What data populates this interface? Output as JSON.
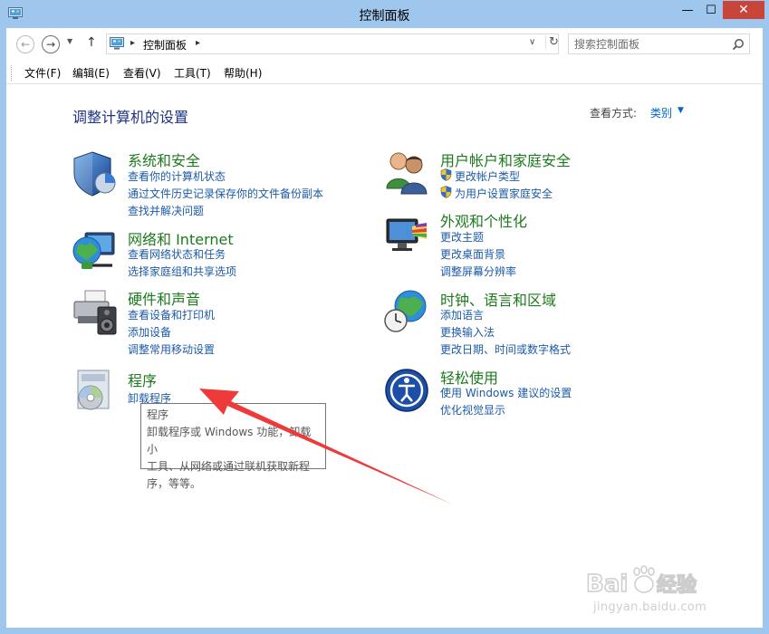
{
  "window": {
    "title": "控制面板",
    "min_glyph": "—",
    "max_glyph": "☐",
    "close_glyph": "✕"
  },
  "nav": {
    "back_glyph": "←",
    "forward_glyph": "→",
    "recent_glyph": "▼",
    "up_glyph": "↑"
  },
  "address": {
    "sep1": "▸",
    "location": "控制面板",
    "sep2": "▸",
    "dropdown_glyph": "∨",
    "refresh_glyph": "↻"
  },
  "search": {
    "placeholder": "搜索控制面板"
  },
  "menu": {
    "file": "文件(F)",
    "edit": "编辑(E)",
    "view": "查看(V)",
    "tools": "工具(T)",
    "help": "帮助(H)"
  },
  "main": {
    "heading": "调整计算机的设置",
    "view_by_label": "查看方式:",
    "view_by_value": "类别",
    "view_by_caret": "▼"
  },
  "categories": {
    "system": {
      "title": "系统和安全",
      "links": [
        "查看你的计算机状态",
        "通过文件历史记录保存你的文件备份副本",
        "查找并解决问题"
      ]
    },
    "network": {
      "title": "网络和 Internet",
      "links": [
        "查看网络状态和任务",
        "选择家庭组和共享选项"
      ]
    },
    "hardware": {
      "title": "硬件和声音",
      "links": [
        "查看设备和打印机",
        "添加设备",
        "调整常用移动设置"
      ]
    },
    "programs": {
      "title": "程序",
      "links": [
        "卸载程序"
      ]
    },
    "users": {
      "title": "用户帐户和家庭安全",
      "links": [
        "更改帐户类型",
        "为用户设置家庭安全"
      ]
    },
    "appearance": {
      "title": "外观和个性化",
      "links": [
        "更改主题",
        "更改桌面背景",
        "调整屏幕分辨率"
      ]
    },
    "clock": {
      "title": "时钟、语言和区域",
      "links": [
        "添加语言",
        "更换输入法",
        "更改日期、时间或数字格式"
      ]
    },
    "ease": {
      "title": "轻松使用",
      "links": [
        "使用 Windows 建议的设置",
        "优化视觉显示"
      ]
    }
  },
  "tooltip": {
    "title": "程序",
    "line1": "卸载程序或 Windows 功能，卸载小",
    "line2": "工具、从网络或通过联机获取新程",
    "line3": "序，等等。"
  },
  "watermark": {
    "logo_text": "Baidu经验",
    "url": "jingyan.baidu.com"
  },
  "colors": {
    "frame": "#9fc6ec",
    "category_title": "#1e7a1e",
    "link": "#1c5ba8",
    "heading": "#1e3287",
    "arrow": "#ee3a3a",
    "close_button": "#c7453a"
  }
}
